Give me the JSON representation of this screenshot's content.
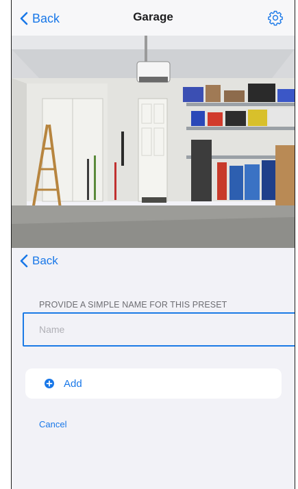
{
  "nav": {
    "back_label": "Back",
    "title": "Garage",
    "settings_icon": "gear-icon"
  },
  "camera": {
    "description_icon": "garage-camera-image"
  },
  "preset": {
    "back_label": "Back",
    "section_label": "PROVIDE A SIMPLE NAME FOR THIS PRESET",
    "name_value": "",
    "name_placeholder": "Name",
    "add_label": "Add",
    "cancel_label": "Cancel"
  },
  "colors": {
    "accent": "#1877e8",
    "background": "#f2f2f7",
    "focus_border": "#1a7ae6"
  }
}
